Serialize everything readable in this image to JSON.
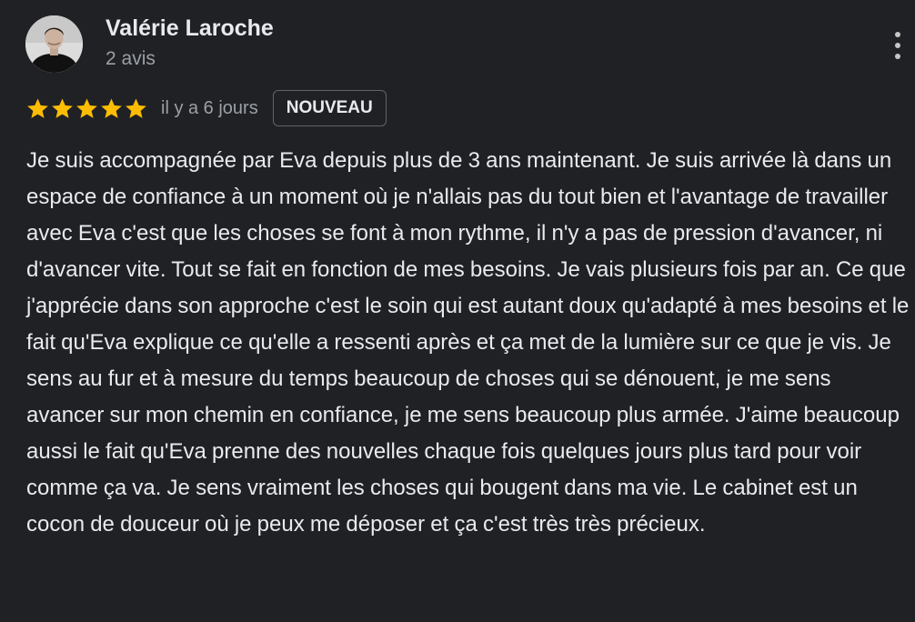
{
  "review": {
    "author_name": "Valérie Laroche",
    "author_meta": "2 avis",
    "rating": 5,
    "rating_max": 5,
    "star_color": "#fbbc04",
    "date": "il y a 6 jours",
    "badge": "NOUVEAU",
    "more_icon": "more-vert-icon",
    "text": "Je suis accompagnée par Eva depuis plus de 3 ans maintenant. Je suis arrivée là dans un espace de confiance à un moment où je n'allais pas du tout bien et l'avantage de travailler avec Eva c'est que les choses se font à mon rythme, il n'y a pas de pression d'avancer, ni d'avancer vite. Tout se fait en fonction de mes besoins. Je vais plusieurs fois par an. Ce que j'apprécie dans son approche c'est le soin qui est autant doux qu'adapté à mes besoins et le fait qu'Eva explique ce qu'elle a ressenti après et ça met de la lumière sur ce que je vis. Je sens au fur et à mesure du temps beaucoup de choses qui se dénouent, je me sens avancer sur mon chemin en confiance, je me sens beaucoup plus armée. J'aime beaucoup aussi le fait qu'Eva prenne des nouvelles chaque fois quelques jours plus tard pour voir comme ça va. Je sens vraiment les choses qui bougent dans ma vie. Le cabinet est un cocon de douceur où je peux me déposer et ça c'est très très précieux."
  }
}
